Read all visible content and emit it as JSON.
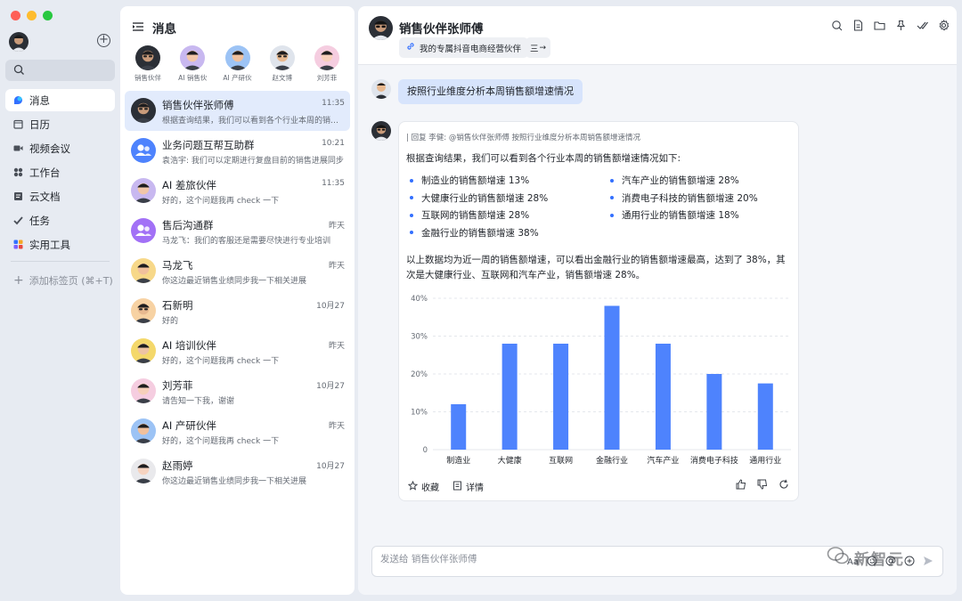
{
  "nav": {
    "items": [
      {
        "label": "消息",
        "icon": "message-icon",
        "active": true
      },
      {
        "label": "日历",
        "icon": "calendar-icon"
      },
      {
        "label": "视频会议",
        "icon": "video-icon"
      },
      {
        "label": "工作台",
        "icon": "workspace-icon"
      },
      {
        "label": "云文档",
        "icon": "doc-icon"
      },
      {
        "label": "任务",
        "icon": "task-icon"
      },
      {
        "label": "实用工具",
        "icon": "tools-icon"
      }
    ],
    "add_tab": "添加标签页 (⌘+T)"
  },
  "list": {
    "title": "消息",
    "stories": [
      {
        "label": "销售伙伴",
        "skin": "#c99b7a",
        "bg": "#2b2f36",
        "glasses": true
      },
      {
        "label": "AI 销售伙",
        "skin": "#f1c6a8",
        "bg": "#c8b8f0"
      },
      {
        "label": "AI 产研伙",
        "skin": "#f0c09c",
        "bg": "#9cc3f5"
      },
      {
        "label": "赵文博",
        "skin": "#e8b990",
        "bg": "#dfe4ec",
        "glasses": true
      },
      {
        "label": "刘芳菲",
        "skin": "#f6d0ba",
        "bg": "#f5cde0"
      }
    ],
    "chats": [
      {
        "name": "销售伙伴张师傅",
        "time": "11:35",
        "preview": "根据查询结果，我们可以看到各个行业本周的销售额增速情况如下",
        "active": true,
        "type": "person",
        "skin": "#c99b7a",
        "bg": "#2b2f36",
        "glasses": true
      },
      {
        "name": "业务问题互帮互助群",
        "time": "10:21",
        "preview": "袁浩宇: 我们可以定期进行复盘目前的销售进展同步",
        "type": "group",
        "bg": "#4e83fd"
      },
      {
        "name": "AI 差旅伙伴",
        "time": "11:35",
        "preview": "好的，这个问题我再 check 一下",
        "type": "person",
        "skin": "#f1c6a8",
        "bg": "#c8b8f0"
      },
      {
        "name": "售后沟通群",
        "time": "昨天",
        "preview": "马龙飞：我们的客服还是需要尽快进行专业培训",
        "type": "group",
        "bg": "#a271f6"
      },
      {
        "name": "马龙飞",
        "time": "昨天",
        "preview": "你这边最近销售业绩同步我一下相关进展",
        "type": "person",
        "skin": "#f0c09c",
        "bg": "#f7d889"
      },
      {
        "name": "石新明",
        "time": "10月27",
        "preview": "好的",
        "type": "person",
        "skin": "#e8b990",
        "bg": "#f7d2a3",
        "glasses": true
      },
      {
        "name": "AI 培训伙伴",
        "time": "昨天",
        "preview": "好的，这个问题我再 check 一下",
        "type": "person",
        "skin": "#edc3a3",
        "bg": "#f4d86b"
      },
      {
        "name": "刘芳菲",
        "time": "10月27",
        "preview": "请告知一下我，谢谢",
        "type": "person",
        "skin": "#f6d0ba",
        "bg": "#f5cde0"
      },
      {
        "name": "AI 产研伙伴",
        "time": "昨天",
        "preview": "好的，这个问题我再 check 一下",
        "type": "person",
        "skin": "#f0c09c",
        "bg": "#9cc3f5"
      },
      {
        "name": "赵雨婷",
        "time": "10月27",
        "preview": "你这边最近销售业绩同步我一下相关进展",
        "type": "person",
        "skin": "#f6d3c0",
        "bg": "#e9e9ec"
      }
    ]
  },
  "conv": {
    "title": "销售伙伴张师傅",
    "tag1": "我的专属抖音电商经营伙伴",
    "tag2": "三",
    "user_message": "按照行业维度分析本周销售额增速情况",
    "reply_ref": "| 回复 李健: @销售伙伴张师傅 按照行业维度分析本周销售额增速情况",
    "intro": "根据查询结果，我们可以看到各个行业本周的销售额增速情况如下:",
    "bullets": [
      "制造业的销售额增速 13%",
      "汽车产业的销售额增速 28%",
      "大健康行业的销售额增速 28%",
      "消费电子科技的销售额增速 20%",
      "互联网的销售额增速 28%",
      "通用行业的销售额增速 18%",
      "金融行业的销售额增速 38%"
    ],
    "summary": "以上数据均为近一周的销售额增速，可以看出金融行业的销售额增速最高，达到了 38%，其次是大健康行业、互联网和汽车产业，销售额增速 28%。",
    "fav_label": "收藏",
    "detail_label": "详情",
    "composer_placeholder": "发送给 销售伙伴张师傅",
    "font_tool": "Aa"
  },
  "watermark": "新智元",
  "colors": {
    "accent": "#3370ff",
    "bar": "#4e83fd"
  },
  "chart_data": {
    "type": "bar",
    "categories": [
      "制造业",
      "大健康",
      "互联网",
      "金融行业",
      "汽车产业",
      "消费电子科技",
      "通用行业"
    ],
    "values": [
      12,
      28,
      28,
      38,
      28,
      20,
      17.5
    ],
    "yticks": [
      "0",
      "10%",
      "20%",
      "30%",
      "40%"
    ],
    "ylim": [
      0,
      40
    ]
  }
}
